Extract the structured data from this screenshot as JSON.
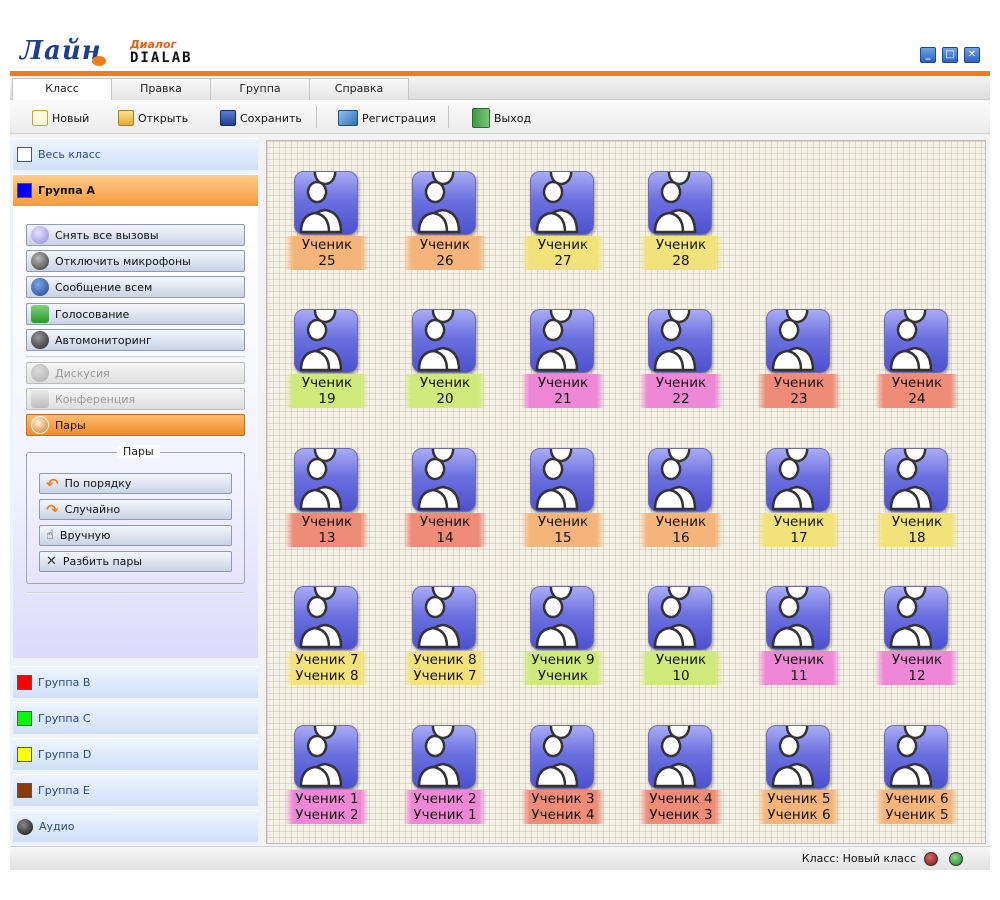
{
  "app": {
    "logo_main": "Лайн",
    "logo_sub1": "Диалог",
    "logo_sub2": "DIALAB",
    "controls": {
      "minimize": "_",
      "maximize": "□",
      "close": "✕"
    }
  },
  "menu": {
    "tabs": [
      {
        "label": "Класс",
        "active": true
      },
      {
        "label": "Правка",
        "active": false
      },
      {
        "label": "Группа",
        "active": false
      },
      {
        "label": "Справка",
        "active": false
      }
    ]
  },
  "toolbar": {
    "new": "Новый",
    "open": "Открыть",
    "save": "Сохранить",
    "register": "Регистрация",
    "exit": "Выход"
  },
  "sidebar": {
    "all_class": "Весь класс",
    "group_a": "Группа A",
    "group_a_color": "#0000ff",
    "actions": [
      {
        "label": "Снять все вызовы",
        "icon": "phone-icon",
        "state": "normal"
      },
      {
        "label": "Отключить микрофоны",
        "icon": "microphone-icon",
        "state": "normal"
      },
      {
        "label": "Сообщение всем",
        "icon": "message-icon",
        "state": "normal"
      },
      {
        "label": "Голосование",
        "icon": "voting-icon",
        "state": "normal"
      },
      {
        "label": "Автомониторинг",
        "icon": "headset-icon",
        "state": "normal"
      },
      {
        "label": "Дискусия",
        "icon": "discussion-icon",
        "state": "disabled"
      },
      {
        "label": "Конференция",
        "icon": "conference-icon",
        "state": "disabled"
      },
      {
        "label": "Пары",
        "icon": "pairs-icon",
        "state": "active"
      }
    ],
    "pairs": {
      "title": "Пары",
      "buttons": [
        {
          "label": "По порядку",
          "icon": "arrow-left-icon"
        },
        {
          "label": "Случайно",
          "icon": "arrow-right-icon"
        },
        {
          "label": "Вручную",
          "icon": "hand-icon"
        },
        {
          "label": "Разбить пары",
          "icon": "x-icon"
        }
      ]
    },
    "groups": [
      {
        "label": "Группа B",
        "color": "#ff0000"
      },
      {
        "label": "Группа C",
        "color": "#00ff00"
      },
      {
        "label": "Группа D",
        "color": "#ffff00"
      },
      {
        "label": "Группа E",
        "color": "#8b3a0a"
      }
    ],
    "audio": "Аудио"
  },
  "students": [
    {
      "line1": "Ученик",
      "line2": "25",
      "color": "#f5b57a"
    },
    {
      "line1": "Ученик",
      "line2": "26",
      "color": "#f5b57a"
    },
    {
      "line1": "Ученик",
      "line2": "27",
      "color": "#f1e27a"
    },
    {
      "line1": "Ученик",
      "line2": "28",
      "color": "#f1e27a"
    },
    {
      "line1": "Ученик",
      "line2": "19",
      "color": "#cfe97a"
    },
    {
      "line1": "Ученик",
      "line2": "20",
      "color": "#cfe97a"
    },
    {
      "line1": "Ученик",
      "line2": "21",
      "color": "#ee88d6"
    },
    {
      "line1": "Ученик",
      "line2": "22",
      "color": "#ee88d6"
    },
    {
      "line1": "Ученик",
      "line2": "23",
      "color": "#ee8c78"
    },
    {
      "line1": "Ученик",
      "line2": "24",
      "color": "#ee8c78"
    },
    {
      "line1": "Ученик",
      "line2": "13",
      "color": "#ee8c78"
    },
    {
      "line1": "Ученик",
      "line2": "14",
      "color": "#ee8c78"
    },
    {
      "line1": "Ученик",
      "line2": "15",
      "color": "#f5b57a"
    },
    {
      "line1": "Ученик",
      "line2": "16",
      "color": "#f5b57a"
    },
    {
      "line1": "Ученик",
      "line2": "17",
      "color": "#f1e27a"
    },
    {
      "line1": "Ученик",
      "line2": "18",
      "color": "#f1e27a"
    },
    {
      "line1": "Ученик 7",
      "line2": "Ученик 8",
      "color": "#f1e27a"
    },
    {
      "line1": "Ученик 8",
      "line2": "Ученик 7",
      "color": "#f1e27a"
    },
    {
      "line1": "Ученик 9",
      "line2": "Ученик",
      "color": "#cfe97a"
    },
    {
      "line1": "Ученик",
      "line2": "10",
      "color": "#cfe97a"
    },
    {
      "line1": "Ученик",
      "line2": "11",
      "color": "#ee88d6"
    },
    {
      "line1": "Ученик",
      "line2": "12",
      "color": "#ee88d6"
    },
    {
      "line1": "Ученик 1",
      "line2": "Ученик 2",
      "color": "#ee88d6"
    },
    {
      "line1": "Ученик 2",
      "line2": "Ученик 1",
      "color": "#ee88d6"
    },
    {
      "line1": "Ученик 3",
      "line2": "Ученик 4",
      "color": "#ee8c78"
    },
    {
      "line1": "Ученик 4",
      "line2": "Ученик 3",
      "color": "#ee8c78"
    },
    {
      "line1": "Ученик 5",
      "line2": "Ученик 6",
      "color": "#f5b57a"
    },
    {
      "line1": "Ученик 6",
      "line2": "Ученик 5",
      "color": "#f5b57a"
    }
  ],
  "status": {
    "text": "Класс: Новый класс",
    "led1_color": "#7a1818",
    "led2_color": "#2a7a2a"
  }
}
